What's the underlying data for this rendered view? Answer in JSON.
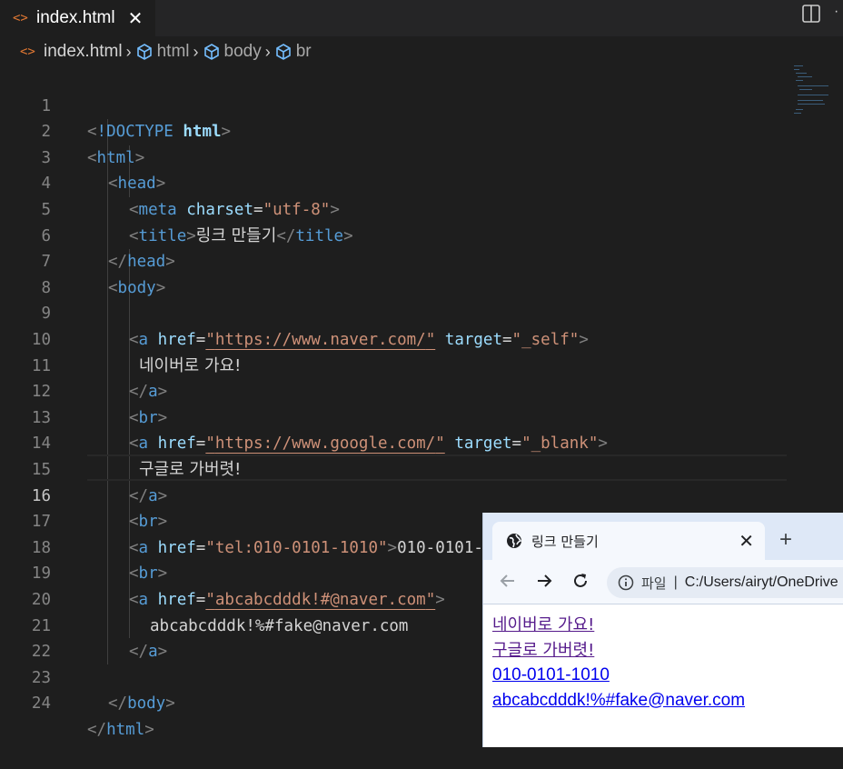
{
  "editor_tab": {
    "label": "index.html",
    "close": "✕"
  },
  "breadcrumb": {
    "file": "index.html",
    "items": [
      "html",
      "body",
      "br"
    ]
  },
  "code": {
    "line_numbers": [
      "1",
      "2",
      "3",
      "4",
      "5",
      "6",
      "7",
      "8",
      "9",
      "10",
      "11",
      "12",
      "13",
      "14",
      "15",
      "16",
      "17",
      "18",
      "19",
      "20",
      "21",
      "22",
      "23",
      "24"
    ],
    "active_line": "16",
    "tags": {
      "doctype": "!DOCTYPE",
      "html": "html",
      "head": "head",
      "meta": "meta",
      "title": "title",
      "body": "body",
      "a": "a",
      "br": "br"
    },
    "attrs": {
      "charset": "charset",
      "href": "href",
      "target": "target"
    },
    "values": {
      "charset": "\"utf-8\"",
      "href1": "https://www.naver.com/",
      "target1": "\"_self\"",
      "href2": "https://www.google.com/",
      "target2": "\"_blank\"",
      "href3": "\"tel:010-0101-1010\"",
      "href4": "abcabcdddk!#@naver.com"
    },
    "texts": {
      "doctype_html": "html",
      "title_text": "링크 만들기",
      "link1_text": "네이버로 가요!",
      "link2_text": "구글로 가버렷!",
      "link3_text": "010-0101-1010",
      "link4_text": "abcabcdddk!%#fake@naver.com"
    }
  },
  "browser": {
    "tab_title": "링크 만들기",
    "close": "✕",
    "new_tab": "+",
    "scheme_label": "파일",
    "url": "C:/Users/airyt/OneDrive",
    "links": [
      {
        "text": "네이버로 가요!"
      },
      {
        "text": "구글로 가버렷!"
      },
      {
        "text": "010-0101-1010"
      },
      {
        "text": "abcabcdddk!%#fake@naver.com"
      }
    ]
  },
  "colors": {
    "tag": "#569cd6",
    "attr": "#9cdcfe",
    "string": "#ce9178",
    "punctuation": "#808080",
    "editor_bg": "#1e1e1e"
  }
}
